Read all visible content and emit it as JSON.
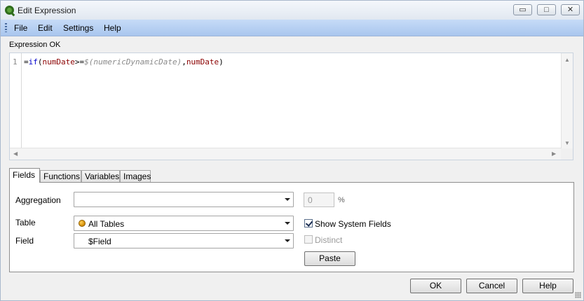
{
  "window": {
    "title": "Edit Expression",
    "minimize": "▭",
    "maximize": "□",
    "close": "✕"
  },
  "menu": {
    "items": [
      "File",
      "Edit",
      "Settings",
      "Help"
    ]
  },
  "expression": {
    "status": "Expression OK",
    "line_number": "1",
    "tokens": [
      "=",
      "if",
      "(",
      "numDate",
      ">=",
      "$(numericDynamicDate)",
      ",",
      "numDate",
      ")"
    ]
  },
  "tabs": [
    "Fields",
    "Functions",
    "Variables",
    "Images"
  ],
  "fields_panel": {
    "aggregation_label": "Aggregation",
    "aggregation_value": "",
    "table_label": "Table",
    "table_value": "All Tables",
    "field_label": "Field",
    "field_value": "$Field",
    "percent_value": "0",
    "percent_unit": "%",
    "show_system_fields": "Show System Fields",
    "show_system_fields_checked": true,
    "distinct": "Distinct",
    "distinct_checked": false,
    "paste": "Paste"
  },
  "buttons": {
    "ok": "OK",
    "cancel": "Cancel",
    "help": "Help"
  },
  "colors": {
    "menubar": "#b5cff2",
    "keyword": "#0000cc",
    "field": "#8b0000",
    "variable": "#8a8a8a"
  }
}
